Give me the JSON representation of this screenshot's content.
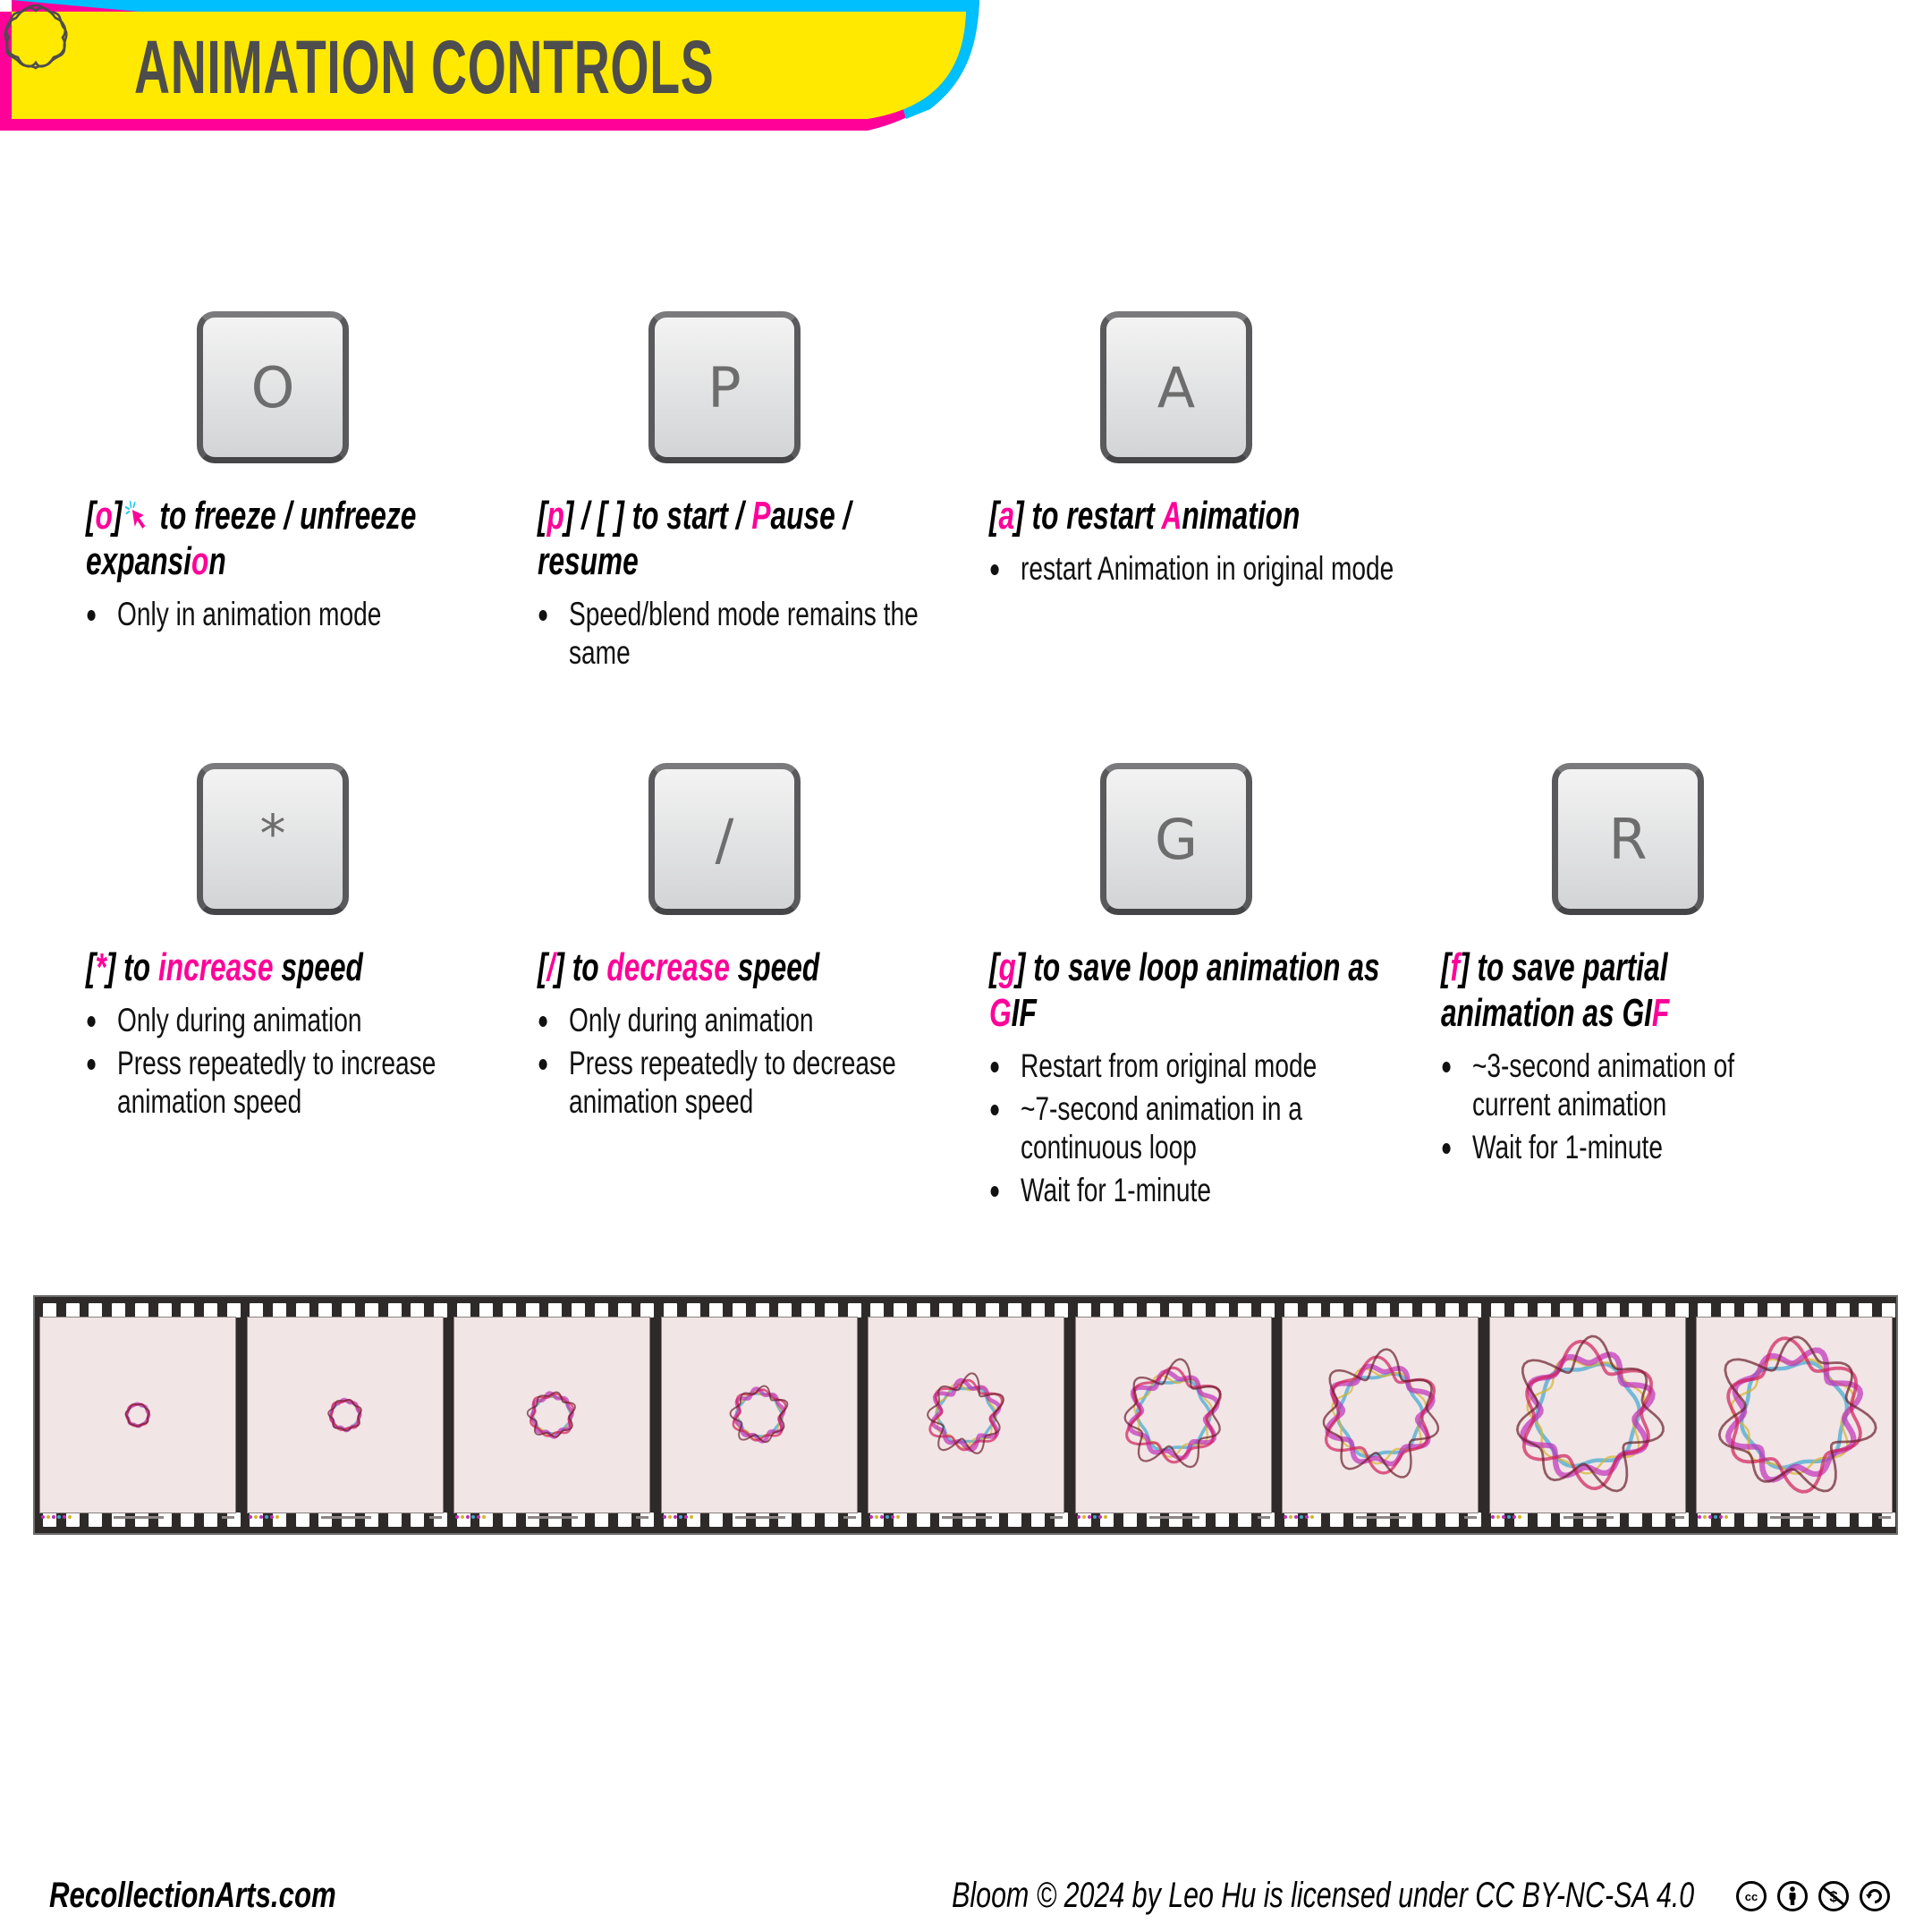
{
  "header": {
    "title": "ANIMATION CONTROLS",
    "logo_icon": "bloom-ring-logo-icon",
    "colors": {
      "yellow": "#ffe900",
      "magenta": "#ff0099",
      "cyan": "#00bfff",
      "title_text": "#4d4d4d"
    }
  },
  "accent_color": "#ff0099",
  "shortcuts": [
    {
      "key": "O",
      "title_parts": [
        {
          "text": "[",
          "hl": false
        },
        {
          "text": "o",
          "hl": true
        },
        {
          "text": "]",
          "hl": false
        },
        {
          "icon": "mouse-cursor-click-icon"
        },
        {
          "text": "to freeze / unfreeze expansi",
          "hl": false
        },
        {
          "text": "o",
          "hl": true
        },
        {
          "text": "n",
          "hl": false
        }
      ],
      "bullets": [
        "Only in animation mode"
      ]
    },
    {
      "key": "P",
      "title_parts": [
        {
          "text": "[",
          "hl": false
        },
        {
          "text": "p",
          "hl": true
        },
        {
          "text": "] / [ ] to start / ",
          "hl": false
        },
        {
          "text": "P",
          "hl": true
        },
        {
          "text": "ause / resume",
          "hl": false
        }
      ],
      "bullets": [
        "Speed/blend mode remains the same"
      ]
    },
    {
      "key": "A",
      "title_parts": [
        {
          "text": "[",
          "hl": false
        },
        {
          "text": "a",
          "hl": true
        },
        {
          "text": "] to restart ",
          "hl": false
        },
        {
          "text": "A",
          "hl": true
        },
        {
          "text": "nimation",
          "hl": false
        }
      ],
      "bullets": [
        "restart Animation in original mode"
      ]
    },
    {
      "key": "*",
      "title_parts": [
        {
          "text": "[",
          "hl": false
        },
        {
          "text": "*",
          "hl": true
        },
        {
          "text": "] to ",
          "hl": false
        },
        {
          "text": "increase",
          "hl": true
        },
        {
          "text": " speed",
          "hl": false
        }
      ],
      "bullets": [
        "Only during animation",
        "Press repeatedly to increase animation speed"
      ]
    },
    {
      "key": "/",
      "title_parts": [
        {
          "text": "[",
          "hl": false
        },
        {
          "text": "/",
          "hl": true
        },
        {
          "text": "] to ",
          "hl": false
        },
        {
          "text": "decrease",
          "hl": true
        },
        {
          "text": " speed",
          "hl": false
        }
      ],
      "bullets": [
        "Only during animation",
        "Press repeatedly to decrease animation speed"
      ]
    },
    {
      "key": "G",
      "title_parts": [
        {
          "text": "[",
          "hl": false
        },
        {
          "text": "g",
          "hl": true
        },
        {
          "text": "] to save loop animation as ",
          "hl": false
        },
        {
          "text": "G",
          "hl": true
        },
        {
          "text": "IF",
          "hl": false
        }
      ],
      "bullets": [
        "Restart from original mode",
        "~7-second animation in a continuous loop",
        "Wait for 1-minute"
      ]
    },
    {
      "key": "R",
      "title_parts": [
        {
          "text": "[",
          "hl": false
        },
        {
          "text": "f",
          "hl": true
        },
        {
          "text": "] to save partial animation as GI",
          "hl": false
        },
        {
          "text": "F",
          "hl": true
        }
      ],
      "bullets": [
        "~3-second animation of current animation",
        "Wait for 1-minute"
      ]
    }
  ],
  "filmstrip": {
    "frame_count": 9,
    "frame_background": "#f1e5e6",
    "ring_colors": [
      "#3fa6d0",
      "#d6b52a",
      "#c02fb8",
      "#d0205a",
      "#6a1f2a"
    ],
    "bloom_scale": [
      0.12,
      0.16,
      0.22,
      0.26,
      0.34,
      0.44,
      0.52,
      0.64,
      0.66
    ],
    "caption_dot_colors": [
      "#c02fb8",
      "#d6b52a",
      "#c02fb8",
      "#3fa6d0",
      "#c02fb8",
      "#d6b52a"
    ]
  },
  "footer": {
    "site": "RecollectionArts.com",
    "license": "Bloom © 2024 by Leo Hu is licensed under CC BY-NC-SA 4.0",
    "license_icons": [
      "cc-icon",
      "by-attribution-icon",
      "nc-noncommercial-icon",
      "sa-sharealike-icon"
    ]
  }
}
